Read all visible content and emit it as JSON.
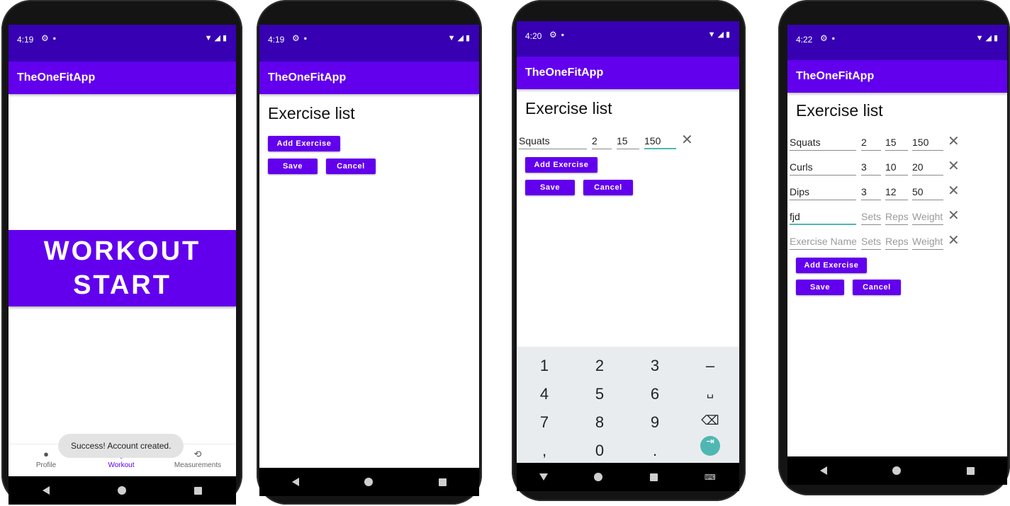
{
  "app_name": "TheOneFitApp",
  "colors": {
    "primary": "#6200ee",
    "primary_dark": "#3700b3",
    "accent": "#4fb7b2"
  },
  "screens": [
    {
      "time": "4:19",
      "workout_start": "WORKOUT START",
      "toast": "Success! Account created.",
      "bottom_nav": [
        {
          "label": "Profile",
          "icon": "person-icon"
        },
        {
          "label": "Workout",
          "icon": "workout-icon"
        },
        {
          "label": "Measurements",
          "icon": "measurements-icon"
        }
      ]
    },
    {
      "time": "4:19",
      "title": "Exercise list",
      "add_exercise": "Add Exercise",
      "save": "Save",
      "cancel": "Cancel"
    },
    {
      "time": "4:20",
      "title": "Exercise list",
      "rows": [
        {
          "name": "Squats",
          "sets": "2",
          "reps": "15",
          "weight": "150"
        }
      ],
      "add_exercise": "Add Exercise",
      "save": "Save",
      "cancel": "Cancel",
      "keyboard": {
        "row1": [
          "1",
          "2",
          "3",
          "–"
        ],
        "row2": [
          "4",
          "5",
          "6",
          "␣"
        ],
        "row3": [
          "7",
          "8",
          "9",
          "⌫"
        ],
        "row4": [
          ",",
          "0",
          ".",
          "⇥"
        ]
      }
    },
    {
      "time": "4:22",
      "title": "Exercise list",
      "rows": [
        {
          "name": "Squats",
          "sets": "2",
          "reps": "15",
          "weight": "150"
        },
        {
          "name": "Curls",
          "sets": "3",
          "reps": "10",
          "weight": "20"
        },
        {
          "name": "Dips",
          "sets": "3",
          "reps": "12",
          "weight": "50"
        },
        {
          "name": "fjd",
          "sets": "",
          "reps": "",
          "weight": ""
        },
        {
          "name": "",
          "sets": "",
          "reps": "",
          "weight": ""
        }
      ],
      "placeholders": {
        "name": "Exercise Name",
        "sets": "Sets",
        "reps": "Reps",
        "weight": "Weight"
      },
      "add_exercise": "Add Exercise",
      "save": "Save",
      "cancel": "Cancel"
    }
  ]
}
